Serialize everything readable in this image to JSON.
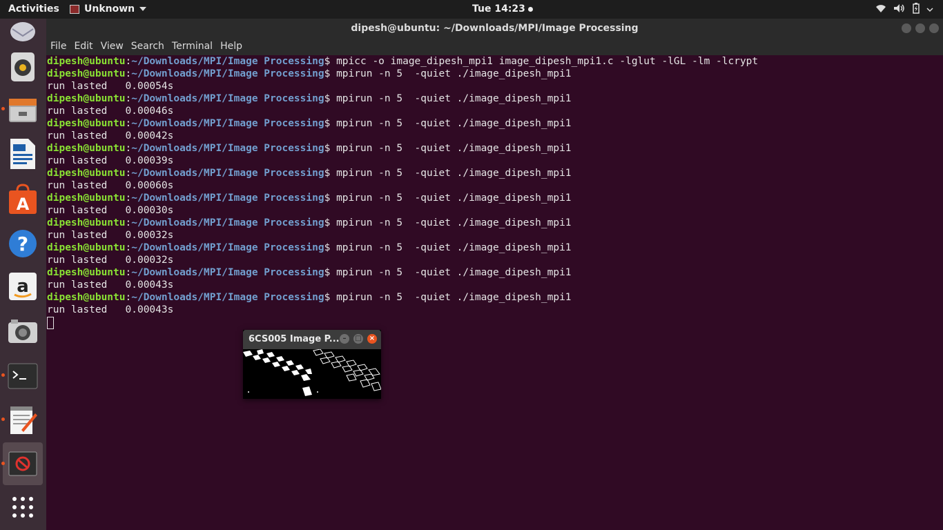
{
  "topbar": {
    "activities": "Activities",
    "app_menu": "Unknown",
    "clock": "Tue 14:23"
  },
  "dock": {
    "icons": [
      "mail-icon",
      "rhythmbox-icon",
      "files-icon",
      "writer-icon",
      "software-center-icon",
      "help-icon",
      "amazon-icon",
      "camera-icon",
      "terminal-icon",
      "text-editor-icon",
      "image-viewer-icon",
      "show-apps-icon"
    ]
  },
  "terminal": {
    "title": "dipesh@ubuntu: ~/Downloads/MPI/Image Processing",
    "menu": [
      "File",
      "Edit",
      "View",
      "Search",
      "Terminal",
      "Help"
    ],
    "prompt_user": "dipesh@ubuntu",
    "prompt_sep": ":",
    "prompt_path": "~/Downloads/MPI/Image Processing",
    "prompt_end": "$ ",
    "compile_cmd": "mpicc -o image_dipesh_mpi1 image_dipesh_mpi1.c -lglut -lGL -lm -lcrypt",
    "run_cmd": "mpirun -n 5  -quiet ./image_dipesh_mpi1",
    "output_prefix": "run lasted   ",
    "timings": [
      "0.00054s",
      "0.00046s",
      "0.00042s",
      "0.00039s",
      "0.00060s",
      "0.00030s",
      "0.00032s",
      "0.00032s",
      "0.00043s",
      "0.00043s"
    ]
  },
  "image_window": {
    "title": "6CS005 Image P..."
  }
}
